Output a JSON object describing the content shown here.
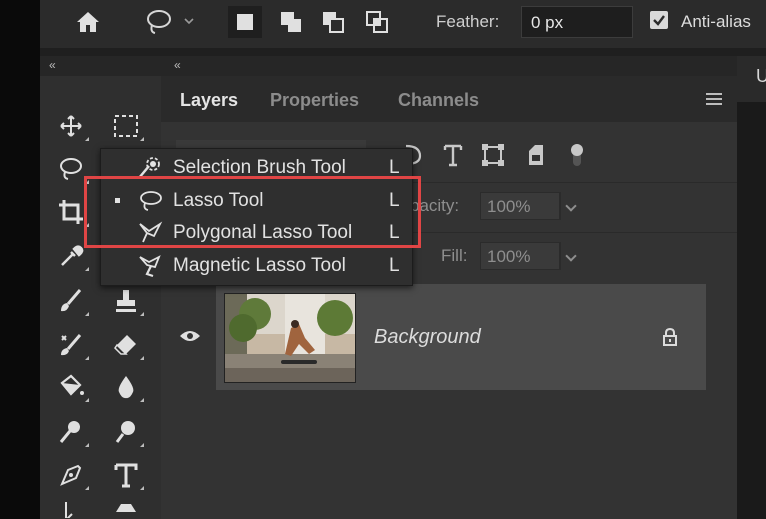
{
  "options_bar": {
    "feather_label": "Feather:",
    "feather_value": "0 px",
    "antialias_label": "Anti-alias",
    "antialias_checked": true
  },
  "toolbar": {
    "collapse_glyph": "«",
    "tools": [
      "move-tool",
      "marquee-tool",
      "lasso-tool",
      "crop-tool",
      "eyedropper-tool",
      "brush-tool",
      "stamp-tool",
      "healing-tool",
      "eraser-tool",
      "paint-bucket-tool",
      "blur-tool",
      "dodge-tool",
      "pen-tool",
      "type-tool",
      "path-selection-tool",
      "shape-tool"
    ]
  },
  "flyout": {
    "items": [
      {
        "label": "Selection Brush Tool",
        "key": "L",
        "icon": "selection-brush-icon",
        "active": false
      },
      {
        "label": "Lasso Tool",
        "key": "L",
        "icon": "lasso-icon",
        "active": true
      },
      {
        "label": "Polygonal Lasso Tool",
        "key": "L",
        "icon": "polygonal-lasso-icon",
        "active": false
      },
      {
        "label": "Magnetic Lasso Tool",
        "key": "L",
        "icon": "magnetic-lasso-icon",
        "active": false
      }
    ],
    "highlight_color": "#e04545"
  },
  "panel": {
    "collapse_glyph": "«",
    "tabs": [
      "Layers",
      "Properties",
      "Channels"
    ],
    "active_tab": "Layers",
    "opacity_label": "pacity:",
    "opacity_value": "100%",
    "fill_label": "Fill:",
    "fill_value": "100%",
    "layers": [
      {
        "name": "Background",
        "visible": true,
        "locked": true
      }
    ]
  },
  "right_tab_letter": "U",
  "colors": {
    "accent_highlight": "#e04545",
    "panel_bg": "#333333",
    "layer_selected": "#4a4a4a"
  }
}
